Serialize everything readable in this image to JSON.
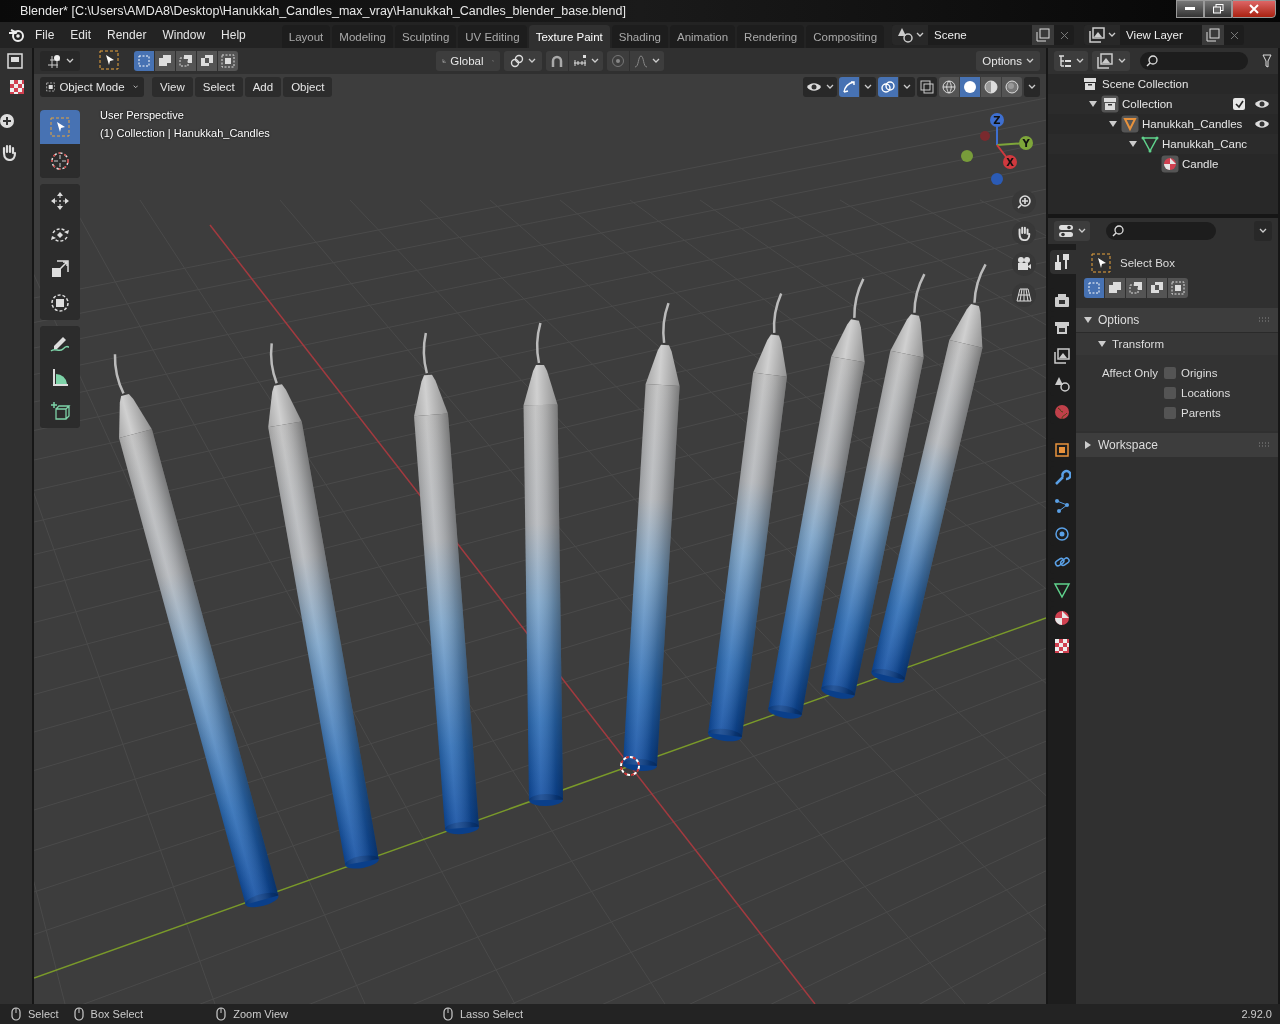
{
  "window": {
    "title": "Blender* [C:\\Users\\AMDA8\\Desktop\\Hanukkah_Candles_max_vray\\Hanukkah_Candles_blender_base.blend]"
  },
  "menu": [
    "File",
    "Edit",
    "Render",
    "Window",
    "Help"
  ],
  "workspaces": [
    {
      "label": "Layout",
      "selected": false
    },
    {
      "label": "Modeling",
      "selected": false
    },
    {
      "label": "Sculpting",
      "selected": false
    },
    {
      "label": "UV Editing",
      "selected": false
    },
    {
      "label": "Texture Paint",
      "selected": true
    },
    {
      "label": "Shading",
      "selected": false
    },
    {
      "label": "Animation",
      "selected": false
    },
    {
      "label": "Rendering",
      "selected": false
    },
    {
      "label": "Compositing",
      "selected": false
    }
  ],
  "scene": {
    "label": "Scene"
  },
  "view_layer": {
    "label": "View Layer"
  },
  "tool_settings": {
    "select_modes": [
      {
        "selected": true
      },
      {
        "selected": false
      },
      {
        "selected": false
      },
      {
        "selected": false
      },
      {
        "selected": false
      }
    ],
    "orientation": "Global",
    "options": "Options"
  },
  "viewport_header": {
    "mode": "Object Mode",
    "menus": [
      "View",
      "Select",
      "Add",
      "Object"
    ],
    "shading": [
      {
        "selected": false
      },
      {
        "selected": true
      },
      {
        "selected": false
      },
      {
        "selected": false
      }
    ]
  },
  "viewport": {
    "view_name": "User Perspective",
    "context": "(1) Collection | Hanukkah_Candles",
    "gizmo_axes": [
      "Z",
      "Y",
      "X"
    ]
  },
  "toolbar": [
    {
      "kind": "select",
      "selected": true
    },
    {
      "kind": "cursor",
      "selected": false
    },
    {
      "kind": "move",
      "selected": false
    },
    {
      "kind": "rotate",
      "selected": false
    },
    {
      "kind": "scale",
      "selected": false
    },
    {
      "kind": "transform",
      "selected": false
    },
    {
      "kind": "annotate",
      "selected": false
    },
    {
      "kind": "measure",
      "selected": false
    },
    {
      "kind": "add_cube",
      "selected": false
    }
  ],
  "outliner": {
    "items": [
      {
        "kind": "scene_collection",
        "label": "Scene Collection",
        "children": [
          {
            "kind": "collection",
            "label": "Collection",
            "expanded": true,
            "checked": true,
            "visible": true,
            "children": [
              {
                "kind": "object",
                "label": "Hanukkah_Candles",
                "expanded": true,
                "visible": true,
                "children": [
                  {
                    "kind": "mesh",
                    "label": "Hanukkah_Canc",
                    "expanded": true,
                    "children": [
                      {
                        "kind": "material",
                        "label": "Candle"
                      }
                    ]
                  }
                ]
              }
            ]
          }
        ]
      }
    ]
  },
  "properties": {
    "tabs": [
      {
        "kind": "tool",
        "selected": true
      },
      {
        "kind": "render",
        "selected": false
      },
      {
        "kind": "output",
        "selected": false
      },
      {
        "kind": "view_layer",
        "selected": false
      },
      {
        "kind": "scene",
        "selected": false
      },
      {
        "kind": "world",
        "selected": false
      },
      {
        "kind": "object",
        "selected": false
      },
      {
        "kind": "modifiers",
        "selected": false
      },
      {
        "kind": "particles",
        "selected": false
      },
      {
        "kind": "physics",
        "selected": false
      },
      {
        "kind": "constraints",
        "selected": false
      },
      {
        "kind": "data",
        "selected": false
      },
      {
        "kind": "material",
        "selected": false
      },
      {
        "kind": "texture",
        "selected": false
      }
    ],
    "tool_name": "Select Box",
    "select_modes": [
      {
        "selected": true
      },
      {
        "selected": false
      },
      {
        "selected": false
      },
      {
        "selected": false
      },
      {
        "selected": false
      }
    ],
    "options_title": "Options",
    "transform_title": "Transform",
    "affect_only": "Affect Only",
    "checkboxes": [
      {
        "label": "Origins",
        "checked": false
      },
      {
        "label": "Locations",
        "checked": false
      },
      {
        "label": "Parents",
        "checked": false
      }
    ],
    "workspace_title": "Workspace"
  },
  "status_bar": {
    "hints": [
      "Select",
      "Box Select",
      "Zoom View",
      "Lasso Select"
    ],
    "version": "2.92.0"
  }
}
